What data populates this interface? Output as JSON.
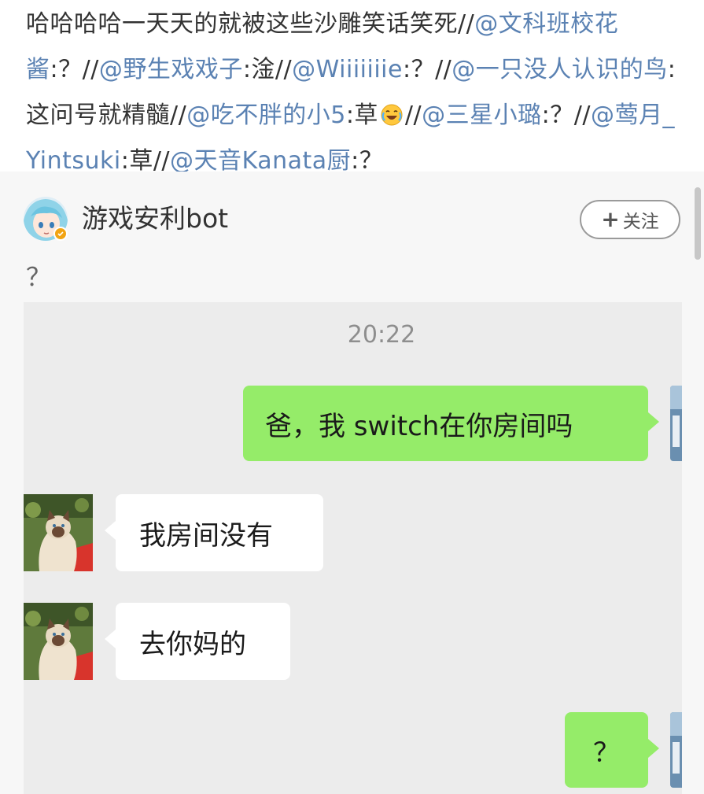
{
  "repost": {
    "segments": [
      {
        "text": "哈哈哈哈一天天的就被这些沙雕笑话笑死//",
        "type": "plain"
      },
      {
        "text": "@文科班校花酱",
        "type": "mention"
      },
      {
        "text": ":？//",
        "type": "plain"
      },
      {
        "text": "@野生戏戏子",
        "type": "mention"
      },
      {
        "text": ":淦//",
        "type": "plain"
      },
      {
        "text": "@Wiiiiiiie",
        "type": "mention"
      },
      {
        "text": ":？//",
        "type": "plain"
      },
      {
        "text": "@一只没人认识的鸟",
        "type": "mention"
      },
      {
        "text": ":这问号就精髓//",
        "type": "plain"
      },
      {
        "text": "@吃不胖的小5",
        "type": "mention"
      },
      {
        "text": ":草",
        "type": "plain"
      },
      {
        "text": "laughing-crying-emoji",
        "type": "emoji"
      },
      {
        "text": "//",
        "type": "plain"
      },
      {
        "text": "@三星小璐",
        "type": "mention"
      },
      {
        "text": ":？//",
        "type": "plain"
      },
      {
        "text": "@莺月_Yintsuki",
        "type": "mention"
      },
      {
        "text": ":草//",
        "type": "plain"
      },
      {
        "text": "@天音Kanata厨",
        "type": "mention"
      },
      {
        "text": ":？",
        "type": "plain"
      }
    ]
  },
  "post": {
    "author_name": "游戏安利bot",
    "follow_label": "关注",
    "follow_plus": "+",
    "text": "？"
  },
  "chat": {
    "time": "20:22",
    "messages": [
      {
        "side": "out",
        "text": "爸，我 switch在你房间吗"
      },
      {
        "side": "in",
        "text": "我房间没有"
      },
      {
        "side": "in",
        "text": "去你妈的"
      },
      {
        "side": "out",
        "text": "？"
      }
    ]
  },
  "colors": {
    "mention": "#5b82b3",
    "outgoing_bubble": "#95ec69",
    "incoming_bubble": "#ffffff",
    "chat_background": "#ececec",
    "post_background": "#f7f7f7"
  }
}
